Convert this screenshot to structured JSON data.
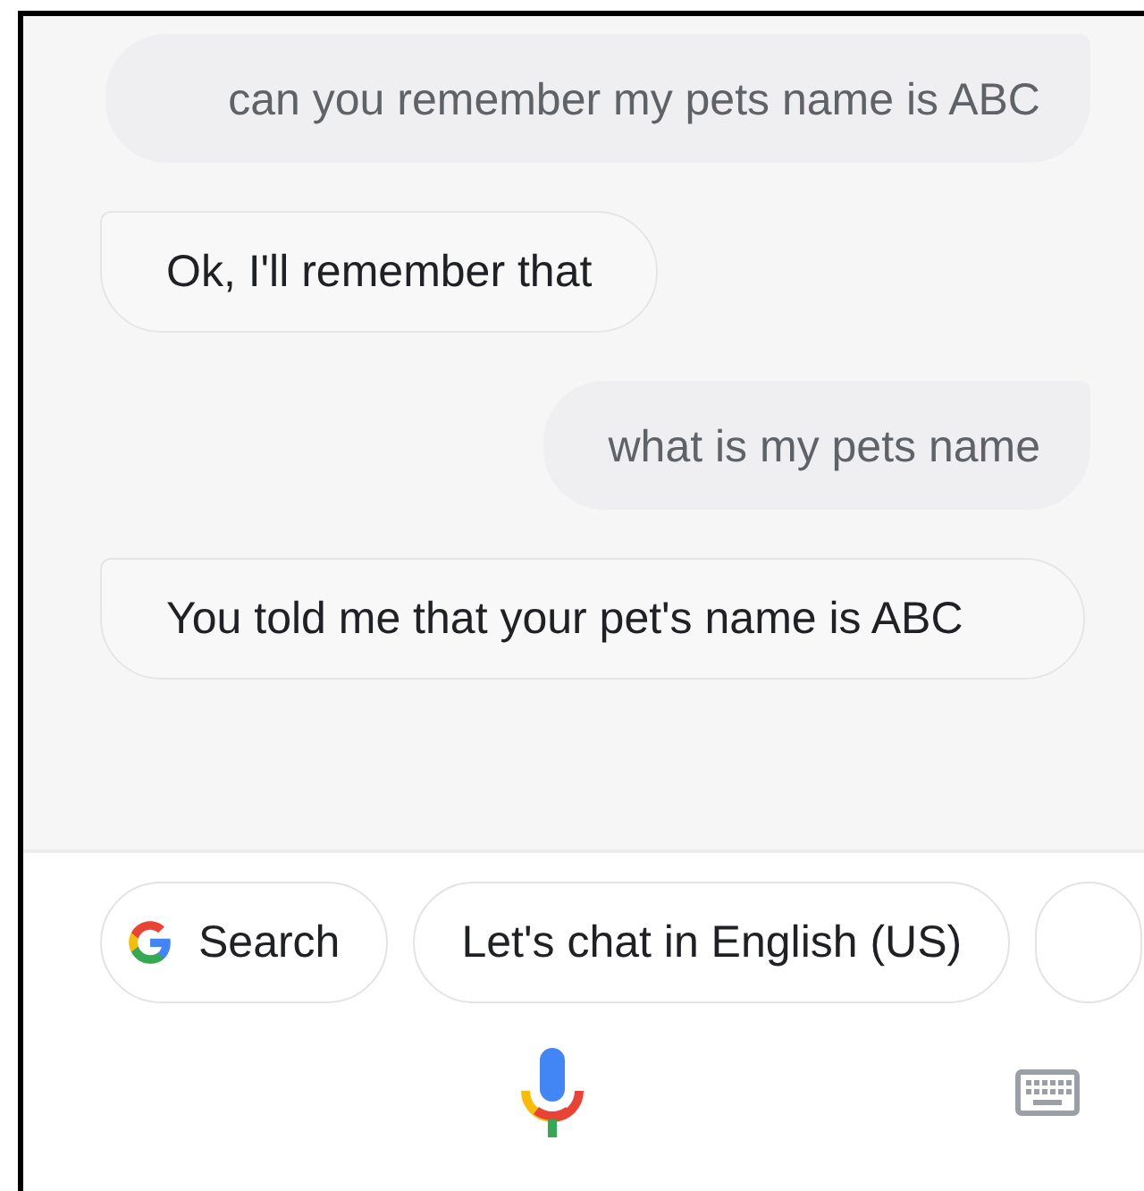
{
  "messages": [
    {
      "kind": "user",
      "text": "can you remember my pets name is ABC"
    },
    {
      "kind": "assistant",
      "text": "Ok, I'll remember that"
    },
    {
      "kind": "user",
      "text": "what is my pets name"
    },
    {
      "kind": "assistant",
      "text": "You told me that your pet's name is ABC"
    }
  ],
  "suggestions": [
    {
      "kind": "search",
      "label": "Search"
    },
    {
      "kind": "text",
      "label": "Let's chat in English (US)"
    }
  ]
}
